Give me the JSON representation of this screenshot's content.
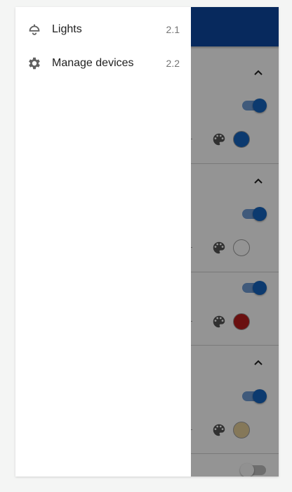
{
  "drawer": {
    "items": [
      {
        "icon": "ceiling-light-icon",
        "label": "Lights",
        "meta": "2.1"
      },
      {
        "icon": "gear-icon",
        "label": "Manage devices",
        "meta": "2.2"
      }
    ]
  },
  "background_app": {
    "accent": "#1565c0",
    "groups": [
      {
        "expanded": true,
        "power_on": true,
        "color": "#1565c0"
      },
      {
        "expanded": true,
        "power_on": true,
        "color": "#ffffff"
      },
      {
        "expanded": false,
        "power_on": true,
        "color": "#b71c1c"
      },
      {
        "expanded": true,
        "power_on": true,
        "color": "#e6cf9a"
      },
      {
        "expanded": false,
        "power_on": false
      }
    ]
  }
}
